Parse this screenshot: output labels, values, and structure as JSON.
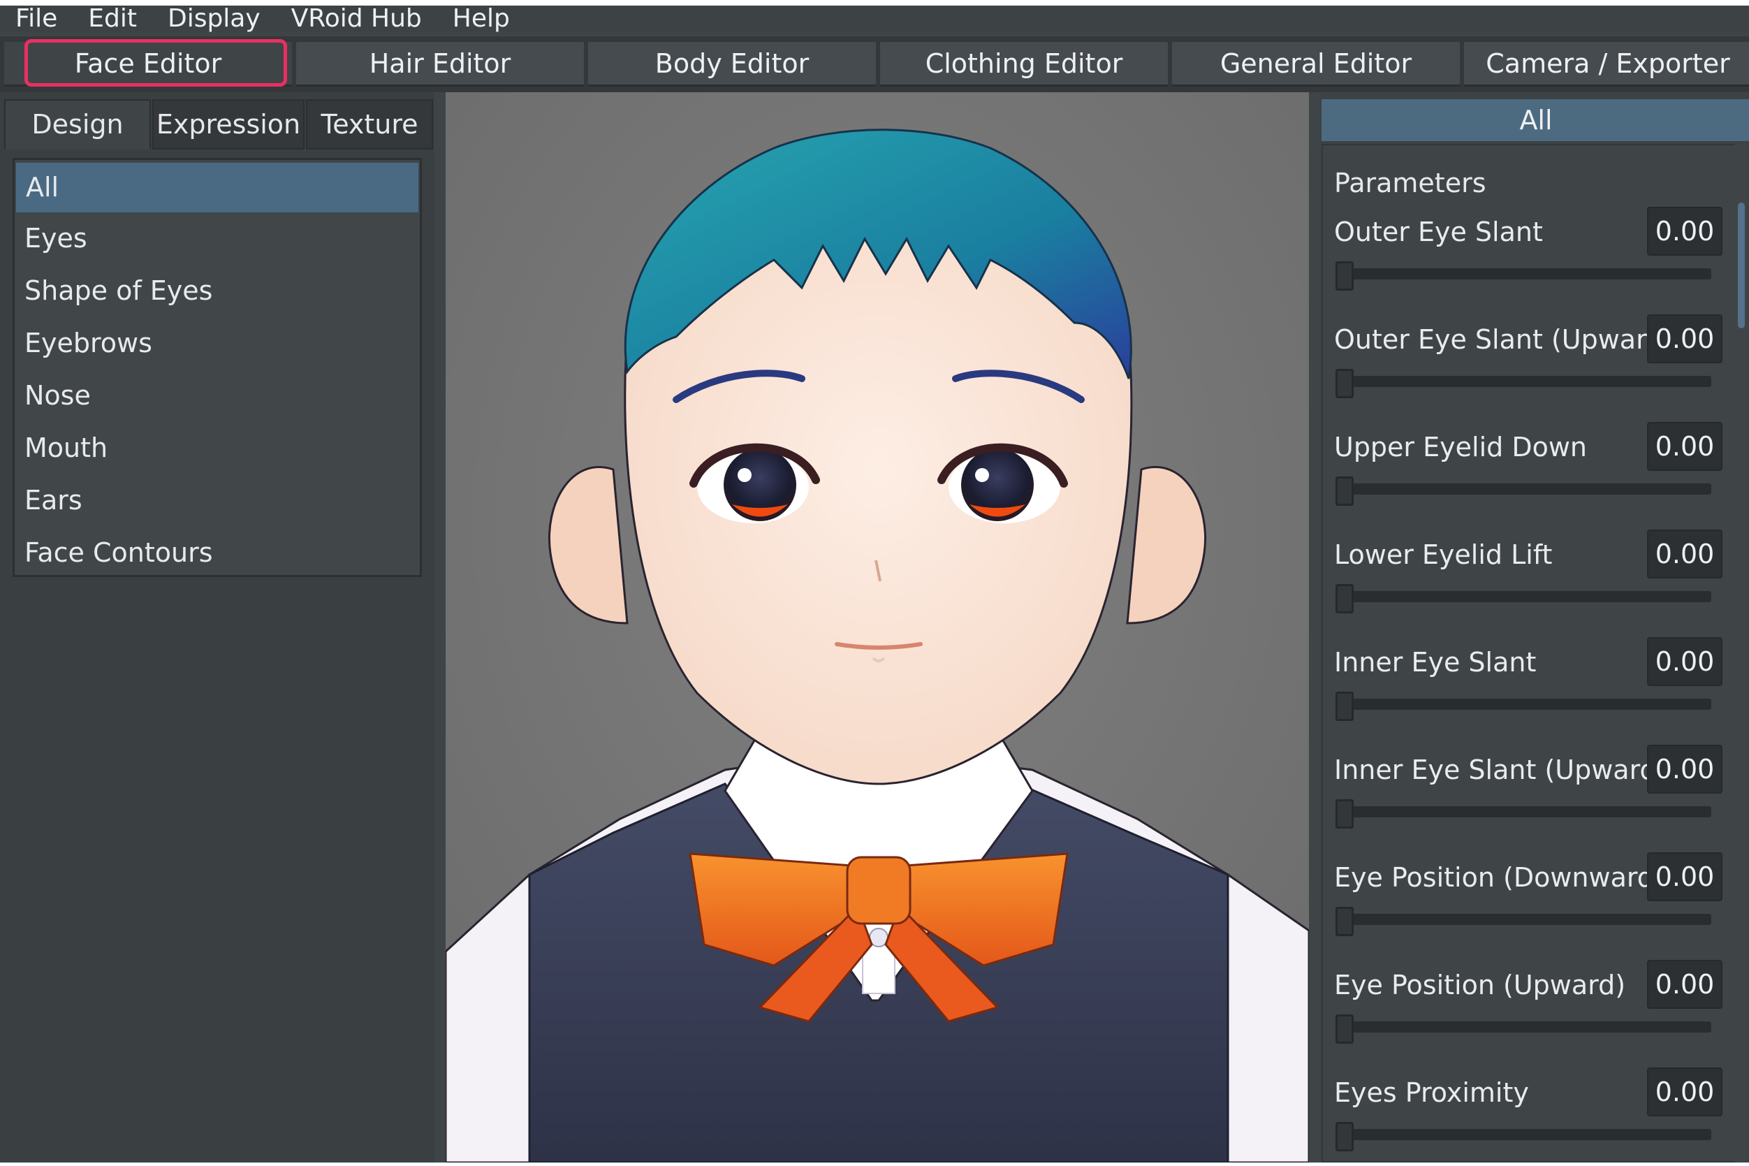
{
  "menu": [
    "File",
    "Edit",
    "Display",
    "VRoid Hub",
    "Help"
  ],
  "editor_tabs": [
    "Face Editor",
    "Hair Editor",
    "Body Editor",
    "Clothing Editor",
    "General Editor",
    "Camera / Exporter"
  ],
  "active_editor_tab": "Face Editor",
  "sub_tabs": [
    "Design",
    "Expression",
    "Texture"
  ],
  "active_sub_tab": "Design",
  "categories": [
    "All",
    "Eyes",
    "Shape of Eyes",
    "Eyebrows",
    "Nose",
    "Mouth",
    "Ears",
    "Face Contours"
  ],
  "selected_category": "All",
  "right_panel": {
    "header": "All",
    "section_title": "Parameters",
    "parameters": [
      {
        "label": "Outer Eye Slant",
        "value": "0.00"
      },
      {
        "label": "Outer Eye Slant (Upward)",
        "value": "0.00"
      },
      {
        "label": "Upper Eyelid Down",
        "value": "0.00"
      },
      {
        "label": "Lower Eyelid Lift",
        "value": "0.00"
      },
      {
        "label": "Inner Eye Slant",
        "value": "0.00"
      },
      {
        "label": "Inner Eye Slant (Upward)",
        "value": "0.00"
      },
      {
        "label": "Eye Position (Downward)",
        "value": "0.00"
      },
      {
        "label": "Eye Position (Upward)",
        "value": "0.00"
      },
      {
        "label": "Eyes Proximity",
        "value": "0.00"
      }
    ]
  },
  "colors": {
    "highlight": "#ea2f63",
    "selected": "#4a6a84",
    "hair": "#1f8fa0",
    "bow": "#f07a1a"
  }
}
